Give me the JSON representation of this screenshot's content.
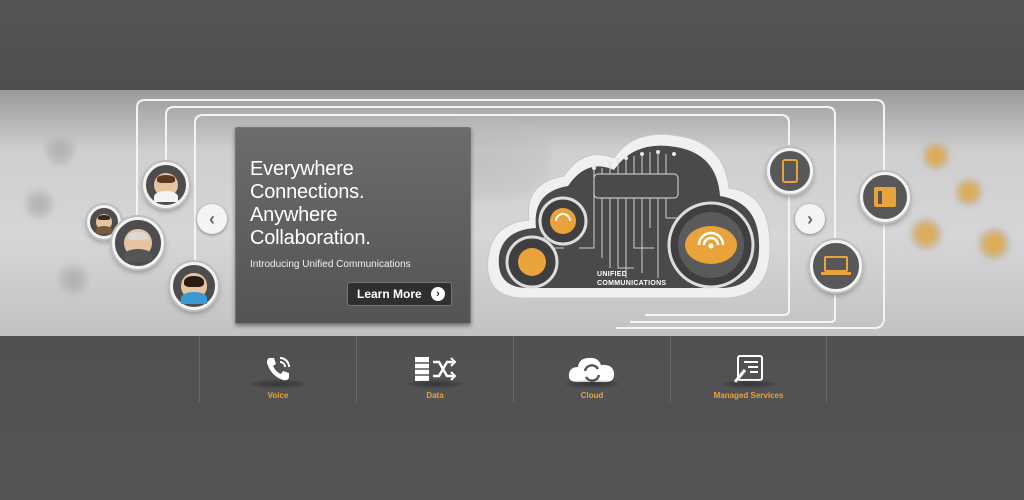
{
  "hero": {
    "headline": [
      "Everywhere",
      "Connections.",
      "Anywhere",
      "Collaboration."
    ],
    "subhead": "Introducing Unified Communications",
    "cta_label": "Learn More",
    "cloud_label": [
      "UNIFIED",
      "COMMUNICATIONS"
    ]
  },
  "carousel": {
    "prev_icon": "chevron-left-icon",
    "next_icon": "chevron-right-icon",
    "prev_glyph": "‹",
    "next_glyph": "›"
  },
  "services": [
    {
      "label": "Voice",
      "icon": "phone-icon"
    },
    {
      "label": "Data",
      "icon": "data-shuffle-icon"
    },
    {
      "label": "Cloud",
      "icon": "cloud-sync-icon"
    },
    {
      "label": "Managed Services",
      "icon": "managed-services-icon"
    }
  ],
  "colors": {
    "accent": "#e8a43a",
    "panel": "#5c5c5e",
    "background": "#555557"
  }
}
